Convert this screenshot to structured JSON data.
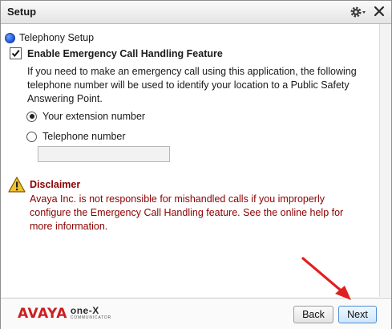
{
  "window": {
    "title": "Setup"
  },
  "titlebar": {
    "gear_icon": "gear-icon",
    "close_icon": "close-icon",
    "close_glyph": "✕"
  },
  "section": {
    "label": "Telephony Setup"
  },
  "emergency": {
    "checkbox_label": "Enable Emergency Call Handling Feature",
    "checked": true,
    "description_lines": [
      "If you need to make an emergency call using this application, the following",
      "telephone number will be used to identify your location to a Public Safety",
      "Answering Point."
    ],
    "options": [
      {
        "label": "Your extension number",
        "selected": true
      },
      {
        "label": "Telephone number",
        "selected": false
      }
    ],
    "telephone_value": ""
  },
  "disclaimer": {
    "icon": "warning-icon",
    "title": "Disclaimer",
    "lines": [
      "Avaya Inc. is not responsible for mishandled calls if you improperly",
      "configure the Emergency Call Handling feature. See the online help for",
      "more information."
    ]
  },
  "footer": {
    "logo_avaya": "AVAYA",
    "logo_onex": "one-X",
    "logo_sub": "COMMUNICATOR",
    "back_label": "Back",
    "next_label": "Next"
  },
  "colors": {
    "disclaimer_text": "#8b0000",
    "brand_red": "#cc1f1f",
    "annotation_arrow": "#e02020"
  }
}
